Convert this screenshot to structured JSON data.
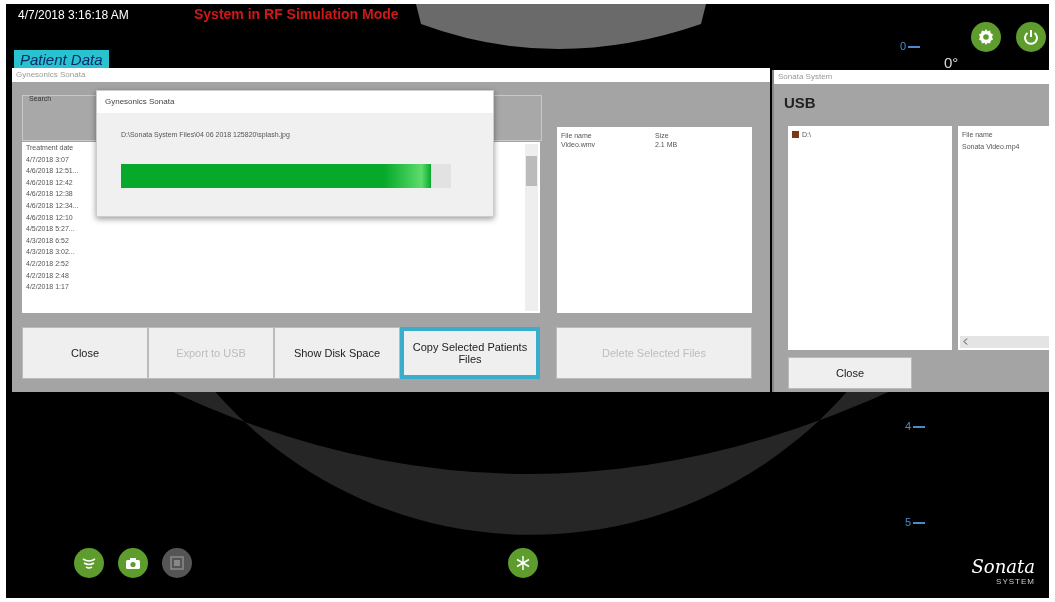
{
  "header": {
    "timestamp": "4/7/2018 3:16:18 AM",
    "mode_banner": "System in RF Simulation Mode"
  },
  "tab": {
    "label": "Patient Data"
  },
  "depth_scale": {
    "marks": [
      "0",
      "4",
      "5"
    ],
    "angle": "0°"
  },
  "patient_window": {
    "title": "Gynesonics Sonata",
    "search_label": "Search",
    "list_header": "Treatment date",
    "dates": [
      "4/7/2018 3:07",
      "4/6/2018 12:51...",
      "4/6/2018 12:42",
      "4/6/2018 12:38",
      "4/6/2018 12:34...",
      "4/6/2018 12:10",
      "4/5/2018 5:27...",
      "4/3/2018 6:52",
      "4/3/2018 3:02...",
      "4/2/2018 2:52",
      "4/2/2018 2:48",
      "4/2/2018 1:17"
    ],
    "file_table": {
      "columns": [
        "File name",
        "Size"
      ],
      "rows": [
        {
          "name": "Video.wmv",
          "size": "2.1 MB"
        }
      ]
    },
    "buttons": [
      {
        "label": "Close",
        "disabled": false,
        "highlighted": false
      },
      {
        "label": "Export to USB",
        "disabled": true,
        "highlighted": false
      },
      {
        "label": "Show Disk Space",
        "disabled": false,
        "highlighted": false
      },
      {
        "label": "Copy Selected Patients Files",
        "disabled": false,
        "highlighted": true
      },
      {
        "label": "Delete Selected Files",
        "disabled": true,
        "highlighted": false
      }
    ]
  },
  "progress_dialog": {
    "title": "Gynesonics Sonata",
    "path": "D:\\Sonata System Files\\04 06 2018 125820\\splash.jpg",
    "level": 0.94
  },
  "usb_window": {
    "title": "Sonata System",
    "heading": "USB",
    "tree": [
      {
        "label": "D:\\"
      }
    ],
    "file_list_header": "File name",
    "files": [
      "Sonata Video.mp4"
    ],
    "close_label": "Close"
  },
  "bottom_tools": [
    {
      "kind": "scan",
      "disabled": false
    },
    {
      "kind": "camera",
      "disabled": false
    },
    {
      "kind": "gallery",
      "disabled": true
    },
    {
      "kind": "freeze",
      "disabled": false
    }
  ],
  "logo": {
    "name": "Sonata",
    "sub": "SYSTEM"
  }
}
